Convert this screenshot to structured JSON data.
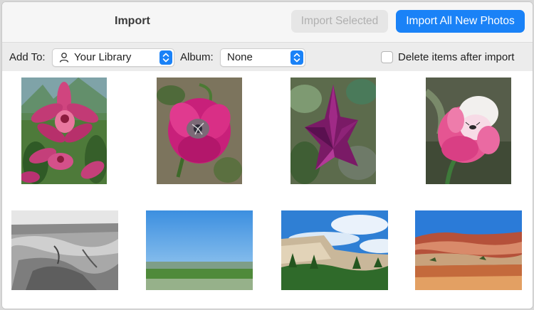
{
  "window": {
    "title": "Import"
  },
  "header": {
    "import_selected_label": "Import Selected",
    "import_all_label": "Import All New Photos"
  },
  "toolbar": {
    "add_to_label": "Add To:",
    "library_value": "Your Library",
    "album_label": "Album:",
    "album_value": "None",
    "delete_after_import_label": "Delete items after import",
    "delete_after_import_checked": false
  },
  "photos": [
    {
      "subject": "pink orchid"
    },
    {
      "subject": "magenta tulip"
    },
    {
      "subject": "purple tulip"
    },
    {
      "subject": "pink and white tulip with insect"
    },
    {
      "subject": "black and white canyon landscape"
    },
    {
      "subject": "blue sky over green field"
    },
    {
      "subject": "cliffs and trees under blue sky"
    },
    {
      "subject": "red rock formation"
    }
  ],
  "colors": {
    "accent": "#1a82f7",
    "disabled_button": "#e6e6e6",
    "toolbar": "#ececec"
  }
}
